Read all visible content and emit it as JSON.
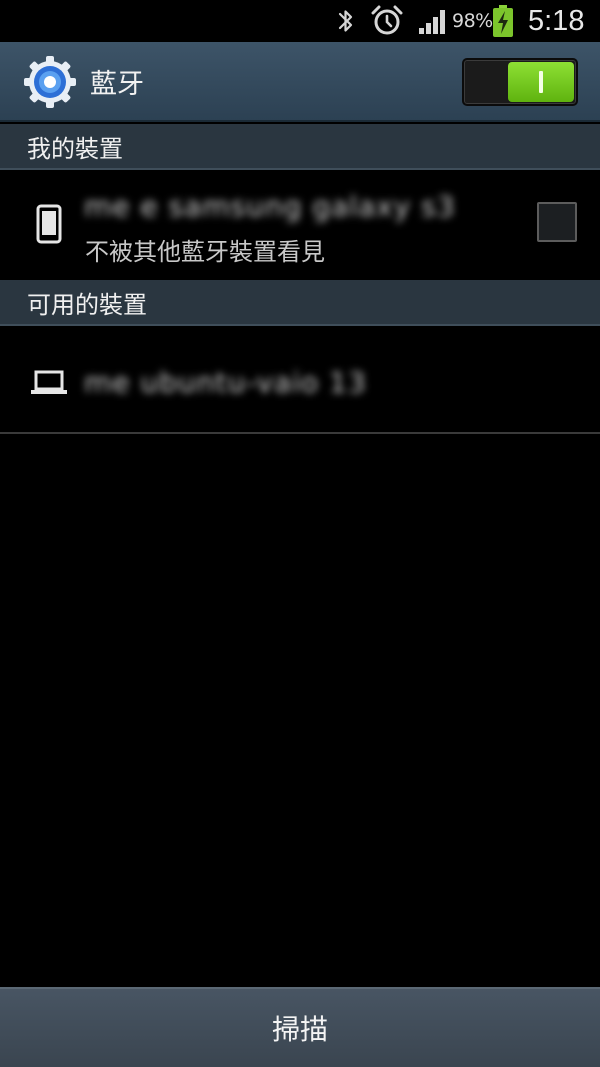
{
  "status_bar": {
    "battery_percent": "98%",
    "time": "5:18",
    "icons": [
      "bluetooth-icon",
      "alarm-icon",
      "signal-icon",
      "battery-charging-icon"
    ]
  },
  "action_bar": {
    "title": "藍牙",
    "icon": "settings-gear-icon",
    "toggle_state": "on",
    "accent_color": "#6cc51d"
  },
  "sections": {
    "my_devices": {
      "header": "我的裝置",
      "device": {
        "name": "me e samsung galaxy s3",
        "subtitle": "不被其他藍牙裝置看見",
        "icon": "phone-icon",
        "checked": false
      }
    },
    "available_devices": {
      "header": "可用的裝置",
      "device": {
        "name": "me ubuntu-vaio 13",
        "icon": "laptop-icon"
      }
    }
  },
  "bottom_bar": {
    "scan_label": "掃描"
  }
}
